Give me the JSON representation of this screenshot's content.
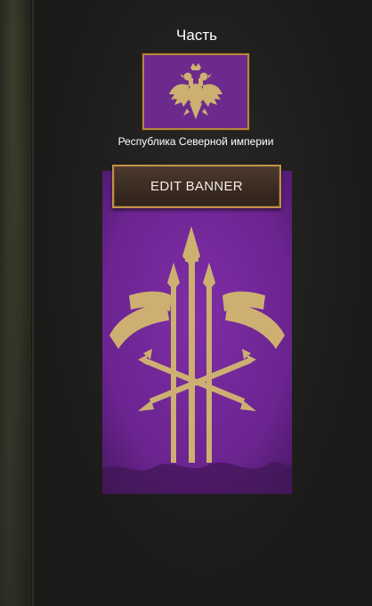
{
  "panel": {
    "title": "Часть",
    "faction_name": "Республика Северной империи",
    "edit_banner_label": "EDIT BANNER"
  },
  "colors": {
    "banner_purple": "#6c2a8c",
    "emblem_gold": "#cdb071",
    "frame_gold": "#b8863b",
    "button_brown": "#3b2b21"
  },
  "icons": {
    "clan_emblem": "double-headed-eagle-icon",
    "banner_emblem": "spears-and-arrows-icon"
  }
}
